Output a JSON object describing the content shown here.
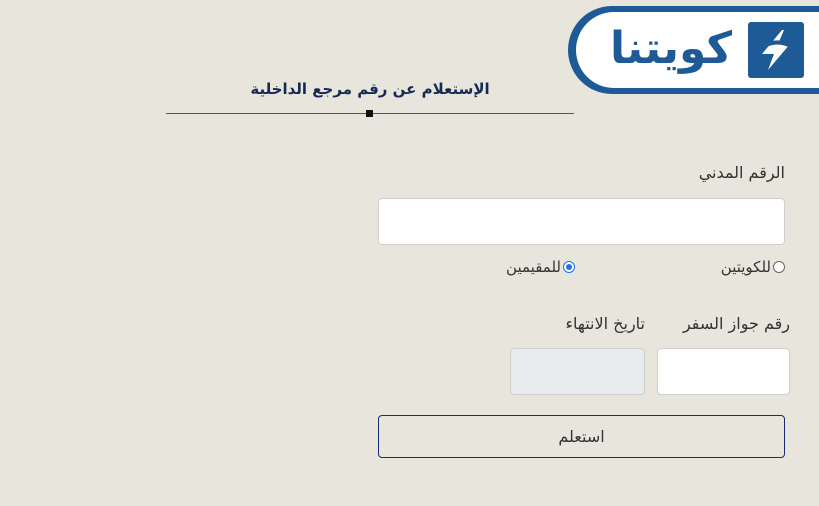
{
  "brand": {
    "logo_text": "كويتنا",
    "logo_icon": "lightning-square-icon",
    "color_primary": "#1d5a96"
  },
  "page": {
    "title": "الإستعلام عن رقم مرجع الداخلية"
  },
  "form": {
    "civil_id_label": "الرقم المدني",
    "civil_id_value": "",
    "nationality_options": [
      {
        "label": "للكويتين",
        "checked": false
      },
      {
        "label": "للمقيمين",
        "checked": true
      }
    ],
    "passport_label": "رقم جواز السفر",
    "passport_value": "",
    "expiry_label": "تاريخ الانتهاء",
    "expiry_value": "",
    "submit_label": "استعلم"
  },
  "colors": {
    "background": "#e8e5dc",
    "title_text": "#142a55",
    "button_border": "#1b2a78",
    "radio_selected": "#1a73e8"
  }
}
